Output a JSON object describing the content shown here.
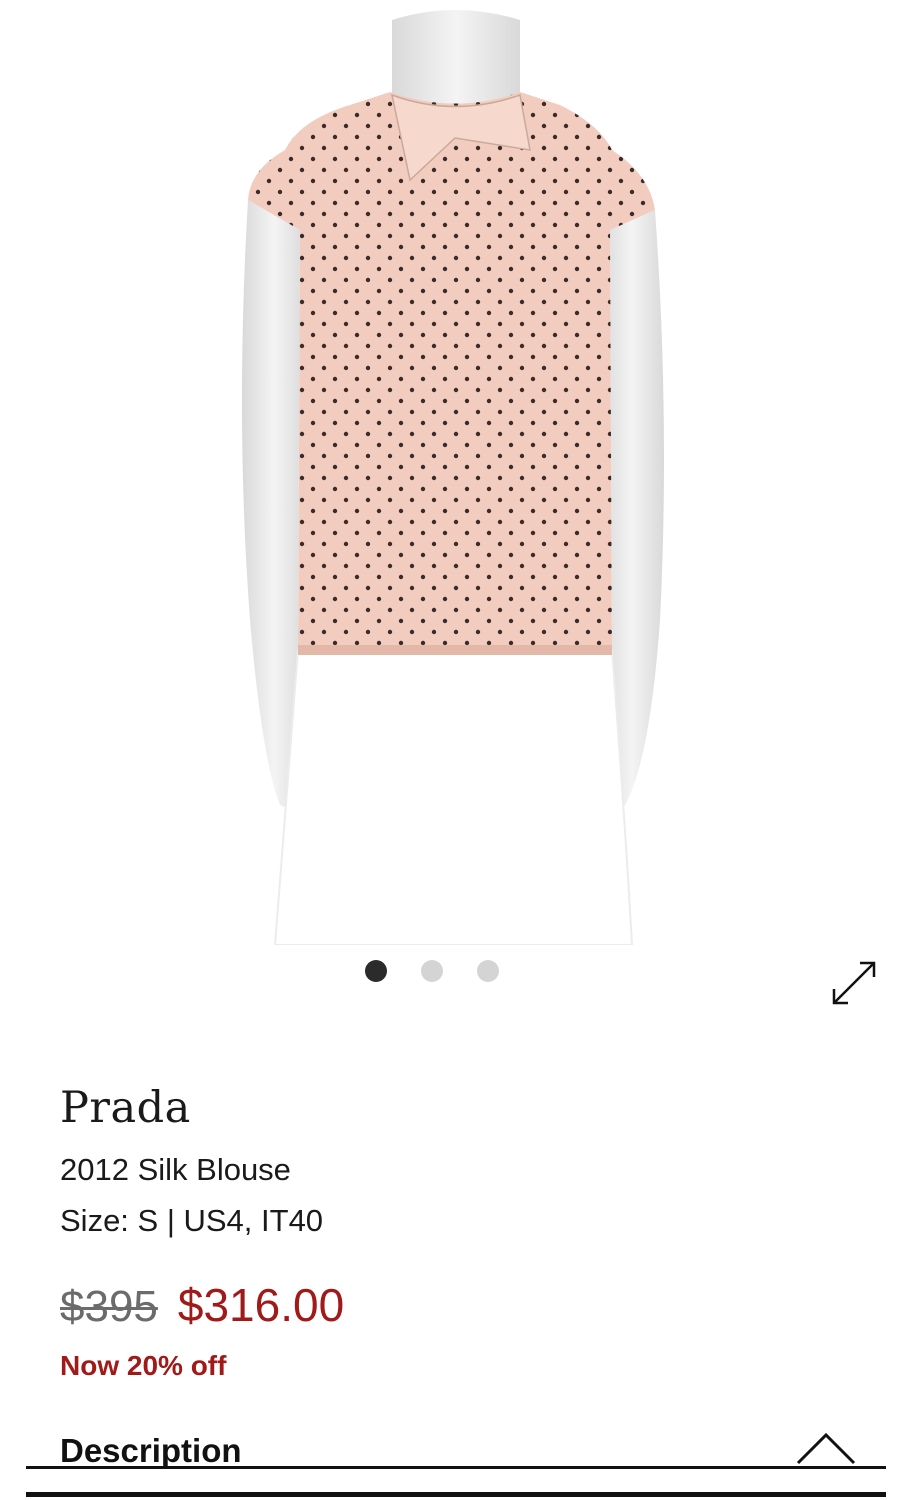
{
  "product": {
    "brand": "Prada",
    "name": "2012 Silk Blouse",
    "size": "Size: S | US4, IT40",
    "original_price": "$395",
    "sale_price": "$316.00",
    "discount_note": "Now 20% off"
  },
  "gallery": {
    "image_subject": "mannequin wearing pink polka dot silk blouse",
    "slides": 3,
    "active_slide": 1,
    "expand_icon": "expand-arrows-icon"
  },
  "description": {
    "title": "Description",
    "toggle_icon": "chevron-up-icon"
  },
  "colors": {
    "sale_red": "#a11a1a",
    "blouse_pink": "#f2cdbf",
    "dot_color": "#3a2a2a"
  }
}
